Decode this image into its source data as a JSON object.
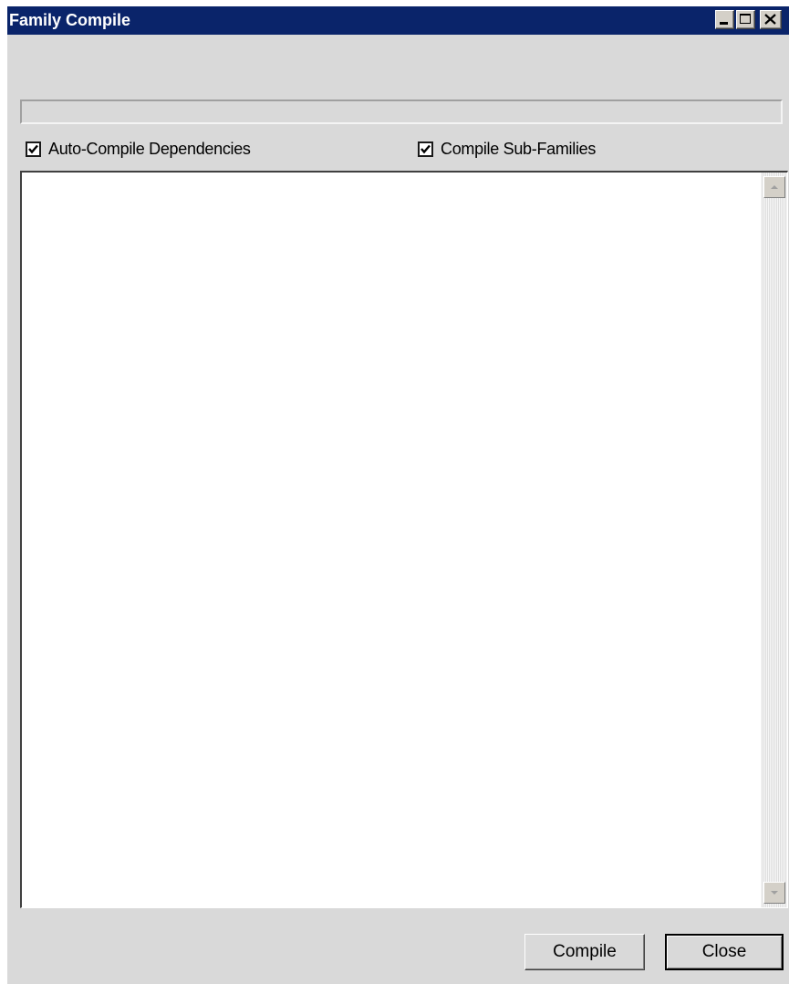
{
  "window": {
    "title": "Family Compile",
    "controls": [
      "minimize-icon",
      "maximize-icon",
      "close-icon"
    ]
  },
  "progress": {
    "value": 0
  },
  "options": {
    "auto_compile": {
      "label": "Auto-Compile Dependencies",
      "checked": true
    },
    "compile_sub": {
      "label": "Compile Sub-Families",
      "checked": true
    }
  },
  "output": {
    "text": ""
  },
  "buttons": {
    "compile_label": "Compile",
    "close_label": "Close"
  },
  "colors": {
    "title_bar": "#0a246a",
    "window_bg": "#d9d9d9"
  }
}
